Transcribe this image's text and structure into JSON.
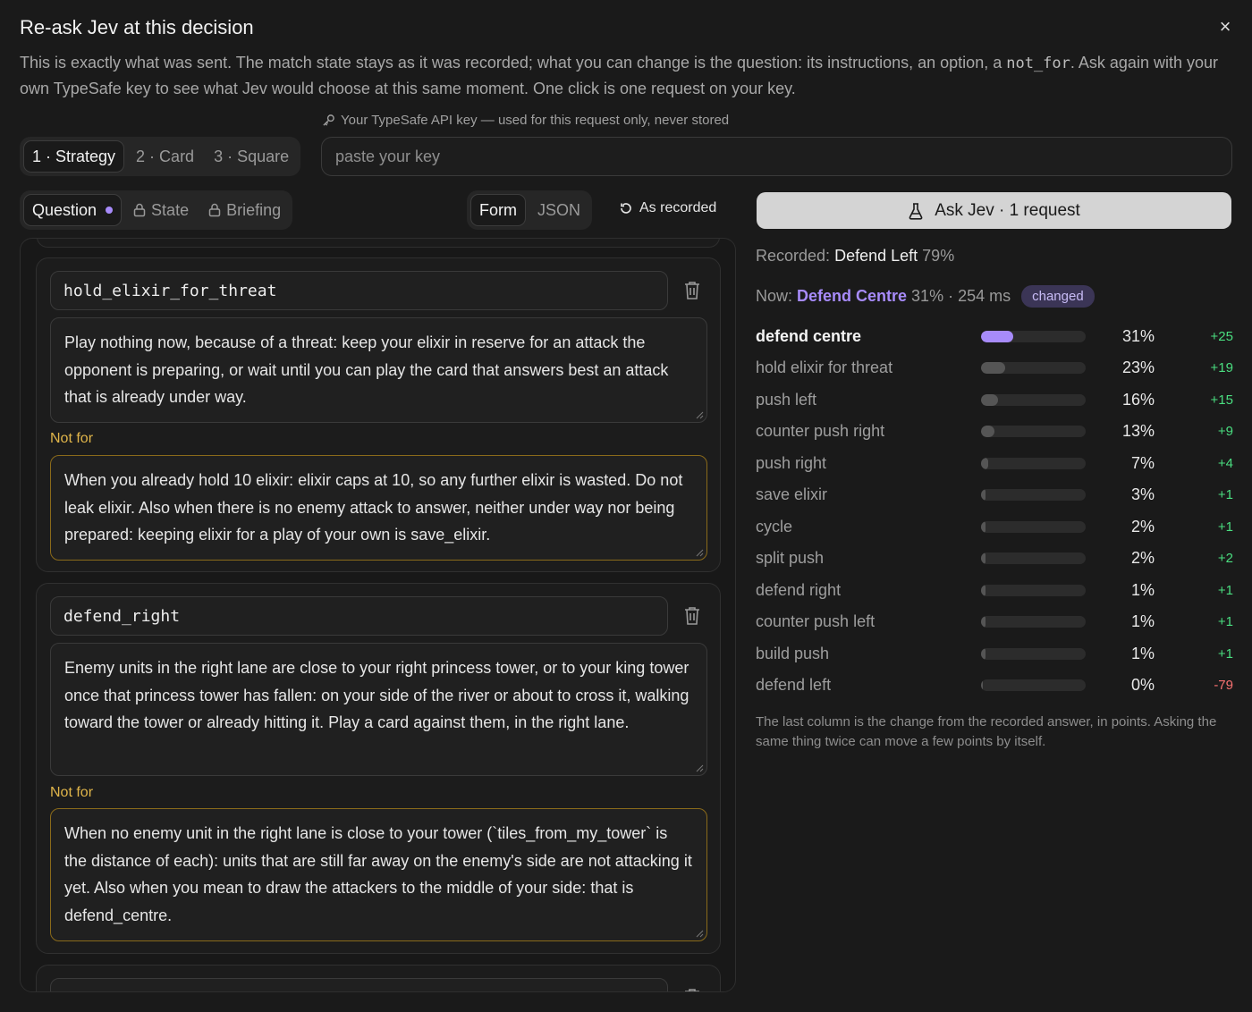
{
  "dialog": {
    "title": "Re-ask Jev at this decision",
    "close_icon": "×",
    "description_pre": "This is exactly what was sent. The match state stays as it was recorded; what you can change is the question: its instructions, an option, a ",
    "description_code": "not_for",
    "description_post": ". Ask again with your own TypeSafe key to see what Jev would choose at this same moment. One click is one request on your key."
  },
  "api_key": {
    "label": "Your TypeSafe API key — used for this request only, never stored",
    "placeholder": "paste your key",
    "value": ""
  },
  "steps": [
    "1 · Strategy",
    "2 · Card",
    "3 · Square"
  ],
  "sections": [
    "Question",
    "State",
    "Briefing"
  ],
  "views": [
    "Form",
    "JSON"
  ],
  "as_recorded_label": "As recorded",
  "options": [
    {
      "name": "hold_elixir_for_threat",
      "description": "Play nothing now, because of a threat: keep your elixir in reserve for an attack the opponent is preparing, or wait until you can play the card that answers best an attack that is already under way.",
      "not_for_label": "Not for",
      "not_for": "When you already hold 10 elixir: elixir caps at 10, so any further elixir is wasted. Do not leak elixir. Also when there is no enemy attack to answer, neither under way nor being prepared: keeping elixir for a play of your own is save_elixir."
    },
    {
      "name": "defend_right",
      "description": "Enemy units in the right lane are close to your right princess tower, or to your king tower once that princess tower has fallen: on your side of the river or about to cross it, walking toward the tower or already hitting it. Play a card against them, in the right lane.",
      "not_for_label": "Not for",
      "not_for": "When no enemy unit in the right lane is close to your tower (`tiles_from_my_tower` is the distance of each): units that are still far away on the enemy's side are not attacking it yet. Also when you mean to draw the attackers to the middle of your side: that is defend_centre."
    }
  ],
  "results": {
    "ask_button": "Ask Jev · 1 request",
    "recorded_label": "Recorded:",
    "recorded_choice": "Defend Left",
    "recorded_pct": "79%",
    "now_label": "Now:",
    "now_choice": "Defend Centre",
    "now_meta": "31% · 254 ms",
    "changed_badge": "changed",
    "accent_color": "#a78bfa",
    "rows": [
      {
        "label": "defend centre",
        "pct": 31,
        "pct_text": "31%",
        "delta": "+25"
      },
      {
        "label": "hold elixir for threat",
        "pct": 23,
        "pct_text": "23%",
        "delta": "+19"
      },
      {
        "label": "push left",
        "pct": 16,
        "pct_text": "16%",
        "delta": "+15"
      },
      {
        "label": "counter push right",
        "pct": 13,
        "pct_text": "13%",
        "delta": "+9"
      },
      {
        "label": "push right",
        "pct": 7,
        "pct_text": "7%",
        "delta": "+4"
      },
      {
        "label": "save elixir",
        "pct": 3,
        "pct_text": "3%",
        "delta": "+1"
      },
      {
        "label": "cycle",
        "pct": 2,
        "pct_text": "2%",
        "delta": "+1"
      },
      {
        "label": "split push",
        "pct": 2,
        "pct_text": "2%",
        "delta": "+2"
      },
      {
        "label": "defend right",
        "pct": 1,
        "pct_text": "1%",
        "delta": "+1"
      },
      {
        "label": "counter push left",
        "pct": 1,
        "pct_text": "1%",
        "delta": "+1"
      },
      {
        "label": "build push",
        "pct": 1,
        "pct_text": "1%",
        "delta": "+1"
      },
      {
        "label": "defend left",
        "pct": 0,
        "pct_text": "0%",
        "delta": "-79"
      }
    ],
    "footnote": "The last column is the change from the recorded answer, in points. Asking the same thing twice can move a few points by itself."
  }
}
